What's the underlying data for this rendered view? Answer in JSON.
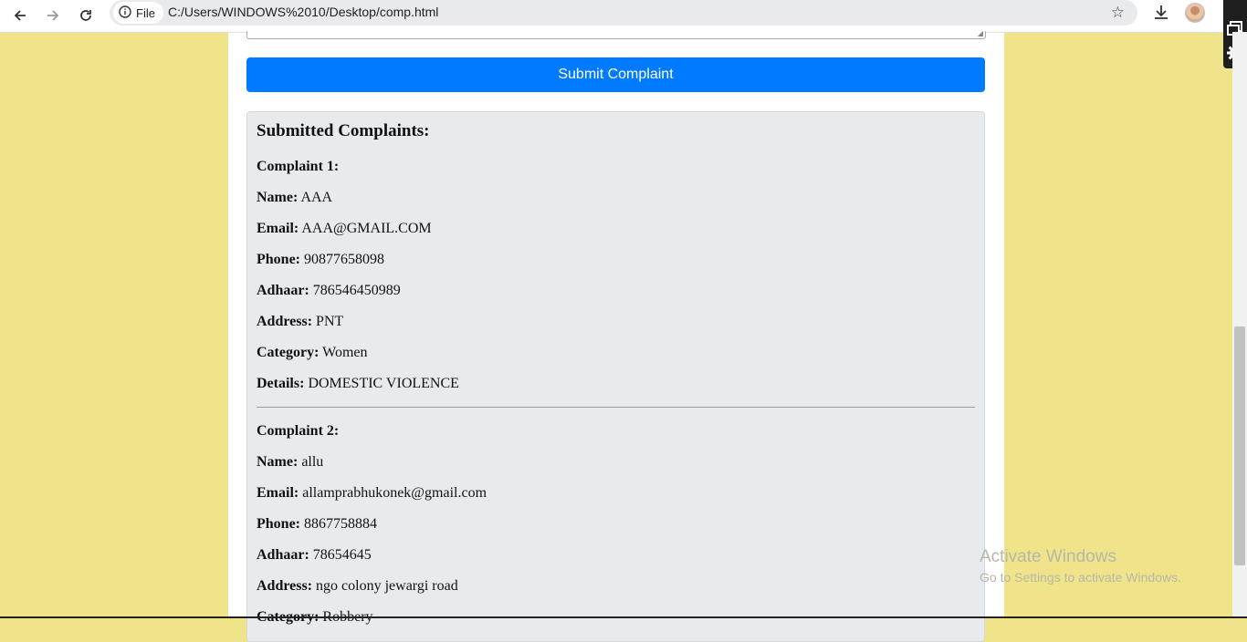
{
  "browser": {
    "site_chip_label": "File",
    "url": "C:/Users/WINDOWS%2010/Desktop/comp.html"
  },
  "form": {
    "submit_label": "Submit Complaint"
  },
  "complaints_section": {
    "title": "Submitted Complaints:",
    "complaints": [
      {
        "heading": "Complaint 1:",
        "name_label": "Name:",
        "name": "AAA",
        "email_label": "Email:",
        "email": "AAA@GMAIL.COM",
        "phone_label": "Phone:",
        "phone": "90877658098",
        "adhaar_label": "Adhaar:",
        "adhaar": "786546450989",
        "address_label": "Address:",
        "address": "PNT",
        "category_label": "Category:",
        "category": "Women",
        "details_label": "Details:",
        "details": "DOMESTIC VIOLENCE"
      },
      {
        "heading": "Complaint 2:",
        "name_label": "Name:",
        "name": "allu",
        "email_label": "Email:",
        "email": "allamprabhukonek@gmail.com",
        "phone_label": "Phone:",
        "phone": "8867758884",
        "adhaar_label": "Adhaar:",
        "adhaar": "78654645",
        "address_label": "Address:",
        "address": "ngo colony jewargi road",
        "category_label": "Category:",
        "category": "Robbery"
      }
    ]
  },
  "watermark": {
    "title": "Activate Windows",
    "subtitle": "Go to Settings to activate Windows."
  }
}
